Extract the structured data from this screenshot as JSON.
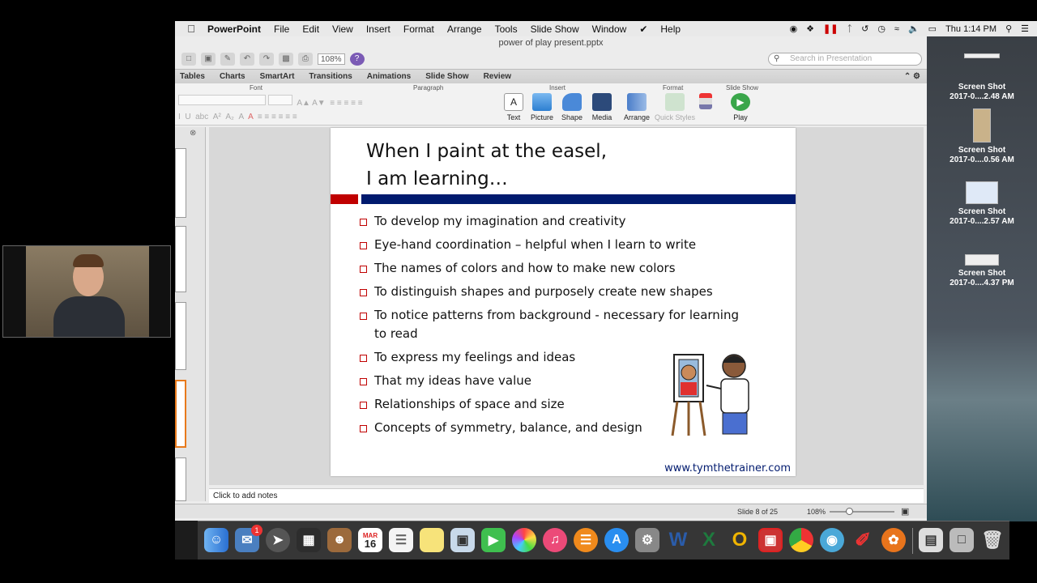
{
  "menubar": {
    "app_name": "PowerPoint",
    "items": [
      "File",
      "Edit",
      "View",
      "Insert",
      "Format",
      "Arrange",
      "Tools",
      "Slide Show",
      "Window",
      "Help"
    ],
    "clock": "Thu 1:14 PM"
  },
  "window": {
    "title": "power of play present.pptx",
    "zoom": "108%",
    "search_placeholder": "Search in Presentation"
  },
  "ribbon": {
    "tabs": [
      "Tables",
      "Charts",
      "SmartArt",
      "Transitions",
      "Animations",
      "Slide Show",
      "Review"
    ],
    "groups": {
      "font": "Font",
      "paragraph": "Paragraph",
      "insert": "Insert",
      "format": "Format",
      "slideshow": "Slide Show"
    },
    "buttons": {
      "text": "Text",
      "picture": "Picture",
      "shape": "Shape",
      "media": "Media",
      "arrange": "Arrange",
      "quick_styles": "Quick Styles",
      "play": "Play"
    }
  },
  "slide": {
    "title_line1": "When I paint at the easel,",
    "title_line2": "I am learning…",
    "bullets": [
      "To develop my imagination and creativity",
      "Eye-hand coordination – helpful when I learn to write",
      "The names of colors and how to make new colors",
      "To distinguish shapes and purposely create new shapes",
      "To notice patterns from background -  necessary for learning to read",
      "To express my feelings and ideas",
      "That my ideas have value",
      "Relationships of space and size",
      "Concepts of symmetry, balance, and design"
    ],
    "website": "www.tymthetrainer.com"
  },
  "notes_placeholder": "Click to add notes",
  "status": {
    "slide_indicator": "Slide 8 of 25",
    "zoom": "108%"
  },
  "desktop_icons": [
    {
      "line1": "Screen Shot",
      "line2": "2017-0....2.48 AM"
    },
    {
      "line1": "Screen Shot",
      "line2": "2017-0....0.56 AM"
    },
    {
      "line1": "Screen Shot",
      "line2": "2017-0....2.57 AM"
    },
    {
      "line1": "Screen Shot",
      "line2": "2017-0....4.37 PM"
    }
  ],
  "dock": {
    "calendar_month": "MAR",
    "calendar_day": "16",
    "mail_badge": "1"
  },
  "colors": {
    "accent_red": "#c00000",
    "accent_blue": "#001a6e"
  }
}
